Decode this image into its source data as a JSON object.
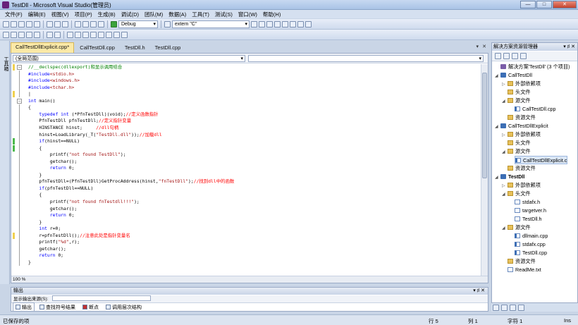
{
  "window": {
    "title": "TestDll - Microsoft Visual Studio(管理员)",
    "min": "—",
    "max": "□",
    "close": "✕"
  },
  "menu": [
    "文件(F)",
    "编辑(E)",
    "视图(V)",
    "项目(P)",
    "生成(B)",
    "调试(D)",
    "团队(M)",
    "数据(A)",
    "工具(T)",
    "测试(S)",
    "窗口(W)",
    "帮助(H)"
  ],
  "toolbar": {
    "config": "Debug",
    "search_value": "extern \"C\""
  },
  "left_panel": {
    "label": "工具箱"
  },
  "tabs": [
    {
      "label": "CallTestDllExplicit.cpp*",
      "active": true
    },
    {
      "label": "CallTestDll.cpp",
      "active": false
    },
    {
      "label": "TestDll.h",
      "active": false
    },
    {
      "label": "TestDll.cpp",
      "active": false
    }
  ],
  "tab_controls": {
    "dropdown": "▾",
    "close": "✕"
  },
  "editor": {
    "scope": "(全局范围)",
    "zoom": "100 %",
    "lines": [
      [
        {
          "t": "//__declspec(dllexport)和显示调用结合",
          "c": "cm"
        }
      ],
      [
        {
          "t": "#include",
          "c": "pp"
        },
        {
          "t": "<stdio.h>",
          "c": "st"
        }
      ],
      [
        {
          "t": "#include",
          "c": "pp"
        },
        {
          "t": "<windows.h>",
          "c": "st"
        }
      ],
      [
        {
          "t": "#include",
          "c": "pp"
        },
        {
          "t": "<tchar.h>",
          "c": "st"
        }
      ],
      [
        {
          "t": "|",
          "c": ""
        }
      ],
      [
        {
          "t": "int",
          "c": "kw"
        },
        {
          "t": " main()",
          "c": ""
        }
      ],
      [
        {
          "t": "{",
          "c": ""
        }
      ],
      [
        {
          "t": "    typedef int",
          "c": "kw"
        },
        {
          "t": " (*PfnTestDll)(void);",
          "c": ""
        },
        {
          "t": "//定义函数指针",
          "c": "cn"
        }
      ],
      [
        {
          "t": "    PfnTestDll pfnTestDll;",
          "c": ""
        },
        {
          "t": "//定义指针变量",
          "c": "cn"
        }
      ],
      [
        {
          "t": "    HINSTANCE hinst;     ",
          "c": ""
        },
        {
          "t": "//dll句柄",
          "c": "cn"
        }
      ],
      [
        {
          "t": "    hinst=LoadLibrary(_T(",
          "c": ""
        },
        {
          "t": "\"TestDll.dll\"",
          "c": "st"
        },
        {
          "t": "));",
          "c": ""
        },
        {
          "t": "//加载dll",
          "c": "cn"
        }
      ],
      [
        {
          "t": "    ",
          "c": ""
        },
        {
          "t": "if",
          "c": "kw"
        },
        {
          "t": "(hinst==NULL)",
          "c": ""
        }
      ],
      [
        {
          "t": "    {",
          "c": ""
        }
      ],
      [
        {
          "t": "        printf(",
          "c": ""
        },
        {
          "t": "\"not found TestDll\"",
          "c": "st"
        },
        {
          "t": ");",
          "c": ""
        }
      ],
      [
        {
          "t": "        getchar();",
          "c": ""
        }
      ],
      [
        {
          "t": "        ",
          "c": ""
        },
        {
          "t": "return",
          "c": "kw"
        },
        {
          "t": " 0;",
          "c": ""
        }
      ],
      [
        {
          "t": "    }",
          "c": ""
        }
      ],
      [
        {
          "t": "    pfnTestDll=(PfnTestDll)GetProcAddress(hinst,",
          "c": ""
        },
        {
          "t": "\"fnTestDll\"",
          "c": "st"
        },
        {
          "t": ");",
          "c": ""
        },
        {
          "t": "//找到dll中的函数",
          "c": "cn"
        }
      ],
      [
        {
          "t": "    ",
          "c": ""
        },
        {
          "t": "if",
          "c": "kw"
        },
        {
          "t": "(pfnTestDll==NULL)",
          "c": ""
        }
      ],
      [
        {
          "t": "    {",
          "c": ""
        }
      ],
      [
        {
          "t": "        printf(",
          "c": ""
        },
        {
          "t": "\"not found fnTestdll!!!\"",
          "c": "st"
        },
        {
          "t": ");",
          "c": ""
        }
      ],
      [
        {
          "t": "        getchar();",
          "c": ""
        }
      ],
      [
        {
          "t": "        ",
          "c": ""
        },
        {
          "t": "return",
          "c": "kw"
        },
        {
          "t": " 0;",
          "c": ""
        }
      ],
      [
        {
          "t": "    }",
          "c": ""
        }
      ],
      [
        {
          "t": "    ",
          "c": ""
        },
        {
          "t": "int",
          "c": "kw"
        },
        {
          "t": " r=0;",
          "c": ""
        }
      ],
      [
        {
          "t": "    r=pfnTestDll();",
          "c": ""
        },
        {
          "t": "//注意此处是指针变量名",
          "c": "cn"
        }
      ],
      [
        {
          "t": "    printf(",
          "c": ""
        },
        {
          "t": "\"%d\"",
          "c": "st"
        },
        {
          "t": ",r);",
          "c": ""
        }
      ],
      [
        {
          "t": "    getchar();",
          "c": ""
        }
      ],
      [
        {
          "t": "    ",
          "c": ""
        },
        {
          "t": "return",
          "c": "kw"
        },
        {
          "t": " 0;",
          "c": ""
        }
      ],
      [
        {
          "t": "}",
          "c": ""
        }
      ]
    ]
  },
  "output": {
    "title": "输出",
    "source_label": "显示输出来源(S):",
    "controls": "▾ ♯ ✕"
  },
  "bottom_tabs": [
    "输出",
    "查找符号结果",
    "断点",
    "调用层次结构"
  ],
  "solution_explorer": {
    "title": "解决方案资源管理器",
    "controls": "▾ ♯ ✕",
    "items": [
      {
        "label": "解决方案'TestDll' (3 个项目)",
        "depth": 0,
        "icon": "sol",
        "arrow": ""
      },
      {
        "label": "CallTestDll",
        "depth": 0,
        "icon": "proj",
        "arrow": "◢"
      },
      {
        "label": "外部依赖项",
        "depth": 1,
        "icon": "folder",
        "arrow": "▷"
      },
      {
        "label": "头文件",
        "depth": 1,
        "icon": "folder",
        "arrow": ""
      },
      {
        "label": "源文件",
        "depth": 1,
        "icon": "folder",
        "arrow": "◢"
      },
      {
        "label": "CallTestDll.cpp",
        "depth": 2,
        "icon": "cpp",
        "arrow": ""
      },
      {
        "label": "资源文件",
        "depth": 1,
        "icon": "folder",
        "arrow": ""
      },
      {
        "label": "CallTestDllExplicit",
        "depth": 0,
        "icon": "proj",
        "arrow": "◢"
      },
      {
        "label": "外部依赖项",
        "depth": 1,
        "icon": "folder",
        "arrow": "▷"
      },
      {
        "label": "头文件",
        "depth": 1,
        "icon": "folder",
        "arrow": ""
      },
      {
        "label": "源文件",
        "depth": 1,
        "icon": "folder",
        "arrow": "◢"
      },
      {
        "label": "CallTestDllExplicit.c",
        "depth": 2,
        "icon": "cpp",
        "arrow": "",
        "selected": true
      },
      {
        "label": "资源文件",
        "depth": 1,
        "icon": "folder",
        "arrow": ""
      },
      {
        "label": "TestDll",
        "depth": 0,
        "icon": "proj",
        "arrow": "◢",
        "bold": true
      },
      {
        "label": "外部依赖项",
        "depth": 1,
        "icon": "folder",
        "arrow": "▷"
      },
      {
        "label": "头文件",
        "depth": 1,
        "icon": "folder",
        "arrow": "◢"
      },
      {
        "label": "stdafx.h",
        "depth": 2,
        "icon": "file",
        "arrow": ""
      },
      {
        "label": "targetver.h",
        "depth": 2,
        "icon": "file",
        "arrow": ""
      },
      {
        "label": "TestDll.h",
        "depth": 2,
        "icon": "file",
        "arrow": ""
      },
      {
        "label": "源文件",
        "depth": 1,
        "icon": "folder",
        "arrow": "◢"
      },
      {
        "label": "dllmain.cpp",
        "depth": 2,
        "icon": "cpp",
        "arrow": ""
      },
      {
        "label": "stdafx.cpp",
        "depth": 2,
        "icon": "cpp",
        "arrow": ""
      },
      {
        "label": "TestDll.cpp",
        "depth": 2,
        "icon": "cpp",
        "arrow": ""
      },
      {
        "label": "资源文件",
        "depth": 1,
        "icon": "folder",
        "arrow": ""
      },
      {
        "label": "ReadMe.txt",
        "depth": 1,
        "icon": "file",
        "arrow": ""
      }
    ]
  },
  "status": {
    "message": "已保存的项",
    "line": "行 5",
    "col": "列 1",
    "char": "字符 1",
    "mode": "Ins"
  }
}
